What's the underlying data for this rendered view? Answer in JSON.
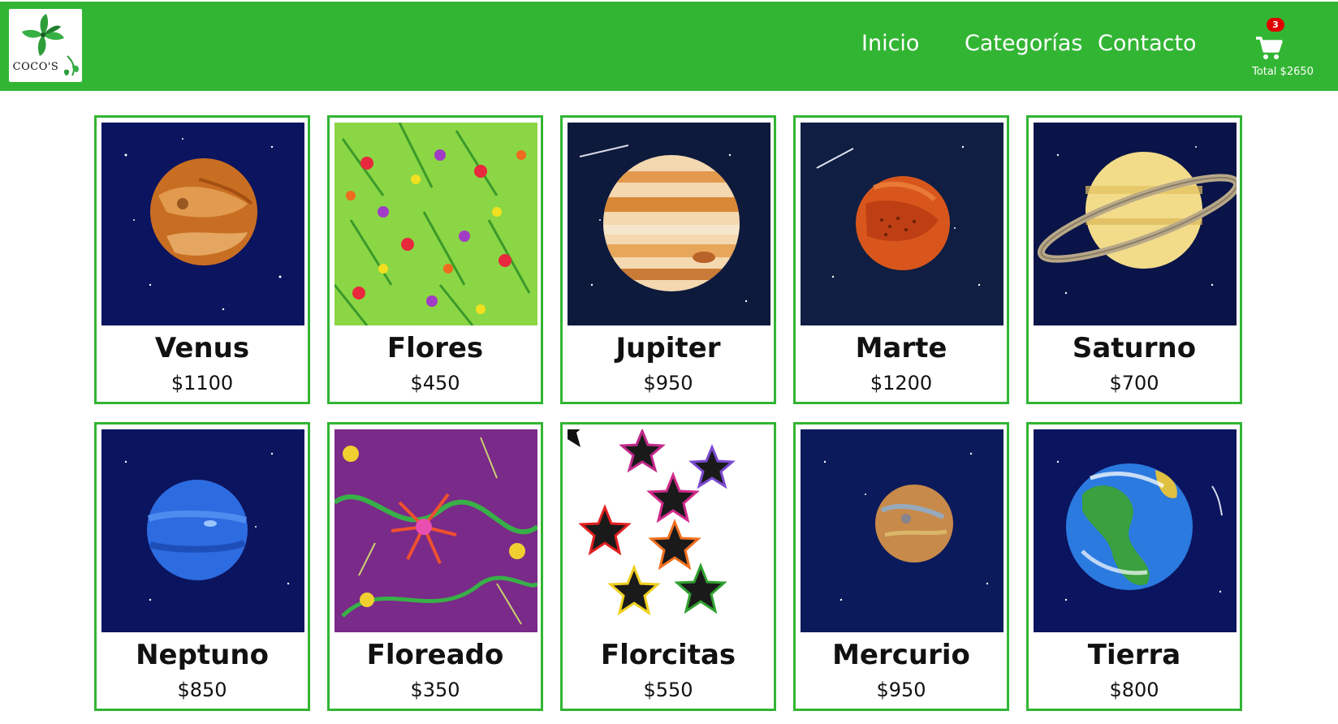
{
  "brand": {
    "logo_text": "COCO'S"
  },
  "nav": {
    "items": [
      "Inicio",
      "Categorías",
      "Contacto"
    ]
  },
  "cart": {
    "count": "3",
    "total": "Total $2650"
  },
  "products": [
    {
      "name": "Venus",
      "price": "$1100"
    },
    {
      "name": "Flores",
      "price": "$450"
    },
    {
      "name": "Jupiter",
      "price": "$950"
    },
    {
      "name": "Marte",
      "price": "$1200"
    },
    {
      "name": "Saturno",
      "price": "$700"
    },
    {
      "name": "Neptuno",
      "price": "$850"
    },
    {
      "name": "Floreado",
      "price": "$350"
    },
    {
      "name": "Florcitas",
      "price": "$550"
    },
    {
      "name": "Mercurio",
      "price": "$950"
    },
    {
      "name": "Tierra",
      "price": "$800"
    }
  ],
  "colors": {
    "header_bg": "#33b534",
    "card_border": "#33b534",
    "badge": "#e00000"
  }
}
